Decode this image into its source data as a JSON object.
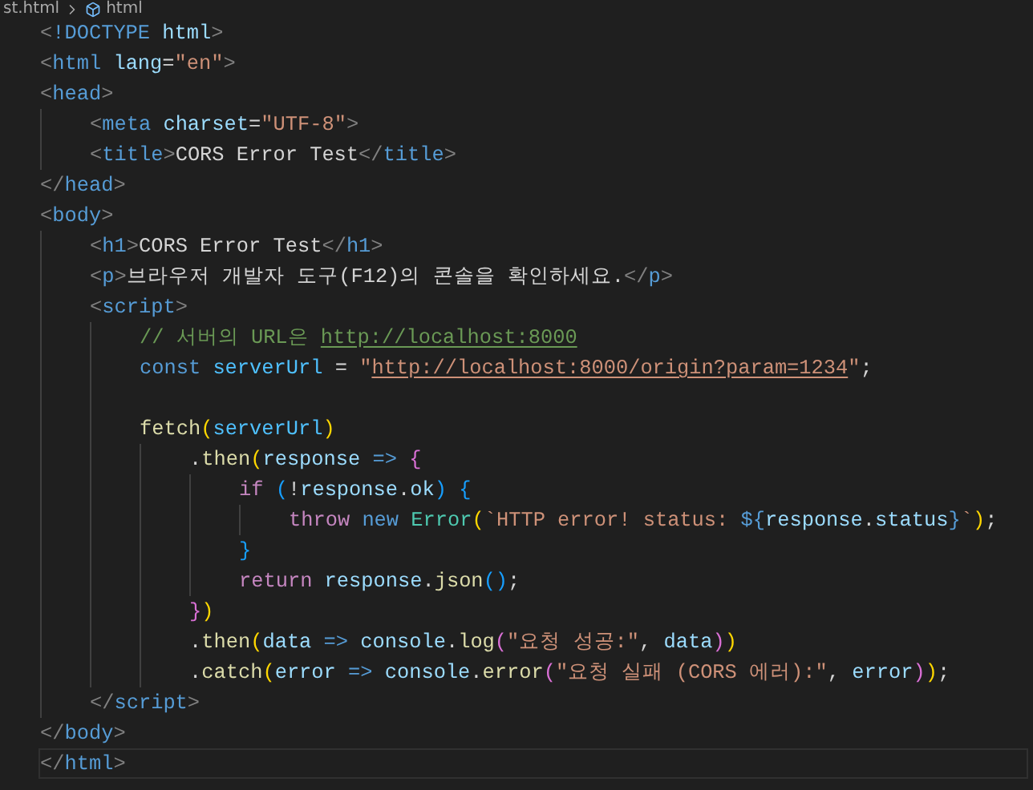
{
  "breadcrumb": {
    "file": "st.html",
    "symbol": "html"
  },
  "lines": [
    {
      "tokens": [
        {
          "kind": "punct",
          "text": "<"
        },
        {
          "kind": "tag",
          "text": "!DOCTYPE"
        },
        {
          "kind": "attr",
          "text": " html"
        },
        {
          "kind": "punct",
          "text": ">"
        }
      ]
    },
    {
      "tokens": [
        {
          "kind": "punct",
          "text": "<"
        },
        {
          "kind": "tag",
          "text": "html"
        },
        {
          "kind": "attr",
          "text": " lang"
        },
        {
          "kind": "text",
          "text": "="
        },
        {
          "kind": "string",
          "text": "\"en\""
        },
        {
          "kind": "punct",
          "text": ">"
        }
      ]
    },
    {
      "tokens": [
        {
          "kind": "punct",
          "text": "<"
        },
        {
          "kind": "tag",
          "text": "head"
        },
        {
          "kind": "punct",
          "text": ">"
        }
      ],
      "children": [
        {
          "tokens": [
            {
              "kind": "punct",
              "text": "<"
            },
            {
              "kind": "tag",
              "text": "meta"
            },
            {
              "kind": "attr",
              "text": " charset"
            },
            {
              "kind": "text",
              "text": "="
            },
            {
              "kind": "string",
              "text": "\"UTF-8\""
            },
            {
              "kind": "punct",
              "text": ">"
            }
          ]
        },
        {
          "tokens": [
            {
              "kind": "punct",
              "text": "<"
            },
            {
              "kind": "tag",
              "text": "title"
            },
            {
              "kind": "punct",
              "text": ">"
            },
            {
              "kind": "text",
              "text": "CORS Error Test"
            },
            {
              "kind": "punct",
              "text": "</"
            },
            {
              "kind": "tag",
              "text": "title"
            },
            {
              "kind": "punct",
              "text": ">"
            }
          ]
        }
      ]
    },
    {
      "tokens": [
        {
          "kind": "punct",
          "text": "</"
        },
        {
          "kind": "tag",
          "text": "head"
        },
        {
          "kind": "punct",
          "text": ">"
        }
      ]
    },
    {
      "tokens": [
        {
          "kind": "punct",
          "text": "<"
        },
        {
          "kind": "tag",
          "text": "body"
        },
        {
          "kind": "punct",
          "text": ">"
        }
      ],
      "children": [
        {
          "tokens": [
            {
              "kind": "punct",
              "text": "<"
            },
            {
              "kind": "tag",
              "text": "h1"
            },
            {
              "kind": "punct",
              "text": ">"
            },
            {
              "kind": "text",
              "text": "CORS Error Test"
            },
            {
              "kind": "punct",
              "text": "</"
            },
            {
              "kind": "tag",
              "text": "h1"
            },
            {
              "kind": "punct",
              "text": ">"
            }
          ]
        },
        {
          "tokens": [
            {
              "kind": "punct",
              "text": "<"
            },
            {
              "kind": "tag",
              "text": "p"
            },
            {
              "kind": "punct",
              "text": ">"
            },
            {
              "kind": "text",
              "text": "브라우저 개발자 도구(F12)의 콘솔을 확인하세요."
            },
            {
              "kind": "punct",
              "text": "</"
            },
            {
              "kind": "tag",
              "text": "p"
            },
            {
              "kind": "punct",
              "text": ">"
            }
          ]
        },
        {
          "tokens": [
            {
              "kind": "punct",
              "text": "<"
            },
            {
              "kind": "tag",
              "text": "script"
            },
            {
              "kind": "punct",
              "text": ">"
            }
          ],
          "children": [
            {
              "tokens": [
                {
                  "kind": "comment",
                  "text": "// 서버의 URL은 "
                },
                {
                  "kind": "comment",
                  "text": "http://localhost:8000",
                  "link": true
                }
              ]
            },
            {
              "tokens": [
                {
                  "kind": "keyword",
                  "text": "const"
                },
                {
                  "kind": "constant",
                  "text": " serverUrl"
                },
                {
                  "kind": "text",
                  "text": " = "
                },
                {
                  "kind": "string",
                  "text": "\""
                },
                {
                  "kind": "string",
                  "text": "http://localhost:8000/origin?param=1234",
                  "link": true
                },
                {
                  "kind": "string",
                  "text": "\""
                },
                {
                  "kind": "text",
                  "text": ";"
                }
              ]
            },
            {
              "blank_line_above": true,
              "tokens": [
                {
                  "kind": "function",
                  "text": "fetch"
                },
                {
                  "kind": "bracket1",
                  "text": "("
                },
                {
                  "kind": "constant",
                  "text": "serverUrl"
                },
                {
                  "kind": "bracket1",
                  "text": ")"
                }
              ],
              "children": [
                {
                  "tokens": [
                    {
                      "kind": "text",
                      "text": "."
                    },
                    {
                      "kind": "function",
                      "text": "then"
                    },
                    {
                      "kind": "bracket1",
                      "text": "("
                    },
                    {
                      "kind": "variable",
                      "text": "response"
                    },
                    {
                      "kind": "keyword",
                      "text": " =>"
                    },
                    {
                      "kind": "bracket2",
                      "text": " {"
                    }
                  ],
                  "children": [
                    {
                      "tokens": [
                        {
                          "kind": "control",
                          "text": "if"
                        },
                        {
                          "kind": "bracket3",
                          "text": " ("
                        },
                        {
                          "kind": "text",
                          "text": "!"
                        },
                        {
                          "kind": "variable",
                          "text": "response"
                        },
                        {
                          "kind": "text",
                          "text": "."
                        },
                        {
                          "kind": "variable",
                          "text": "ok"
                        },
                        {
                          "kind": "bracket3",
                          "text": ")"
                        },
                        {
                          "kind": "bracket3",
                          "text": " {"
                        }
                      ],
                      "children": [
                        {
                          "tokens": [
                            {
                              "kind": "control",
                              "text": "throw"
                            },
                            {
                              "kind": "keyword",
                              "text": " new"
                            },
                            {
                              "kind": "class",
                              "text": " Error"
                            },
                            {
                              "kind": "bracket1",
                              "text": "("
                            },
                            {
                              "kind": "string",
                              "text": "`HTTP error! status: "
                            },
                            {
                              "kind": "keyword",
                              "text": "${"
                            },
                            {
                              "kind": "variable",
                              "text": "response"
                            },
                            {
                              "kind": "text",
                              "text": "."
                            },
                            {
                              "kind": "variable",
                              "text": "status"
                            },
                            {
                              "kind": "keyword",
                              "text": "}"
                            },
                            {
                              "kind": "string",
                              "text": "`"
                            },
                            {
                              "kind": "bracket1",
                              "text": ")"
                            },
                            {
                              "kind": "text",
                              "text": ";"
                            }
                          ]
                        }
                      ]
                    },
                    {
                      "tokens": [
                        {
                          "kind": "bracket3",
                          "text": "}"
                        }
                      ]
                    },
                    {
                      "tokens": [
                        {
                          "kind": "control",
                          "text": "return"
                        },
                        {
                          "kind": "variable",
                          "text": " response"
                        },
                        {
                          "kind": "text",
                          "text": "."
                        },
                        {
                          "kind": "function",
                          "text": "json"
                        },
                        {
                          "kind": "bracket3",
                          "text": "()"
                        },
                        {
                          "kind": "text",
                          "text": ";"
                        }
                      ]
                    }
                  ]
                },
                {
                  "tokens": [
                    {
                      "kind": "bracket2",
                      "text": "}"
                    },
                    {
                      "kind": "bracket1",
                      "text": ")"
                    }
                  ]
                },
                {
                  "tokens": [
                    {
                      "kind": "text",
                      "text": "."
                    },
                    {
                      "kind": "function",
                      "text": "then"
                    },
                    {
                      "kind": "bracket1",
                      "text": "("
                    },
                    {
                      "kind": "variable",
                      "text": "data"
                    },
                    {
                      "kind": "keyword",
                      "text": " =>"
                    },
                    {
                      "kind": "variable",
                      "text": " console"
                    },
                    {
                      "kind": "text",
                      "text": "."
                    },
                    {
                      "kind": "function",
                      "text": "log"
                    },
                    {
                      "kind": "bracket2",
                      "text": "("
                    },
                    {
                      "kind": "string",
                      "text": "\"요청 성공:\""
                    },
                    {
                      "kind": "text",
                      "text": ","
                    },
                    {
                      "kind": "variable",
                      "text": " data"
                    },
                    {
                      "kind": "bracket2",
                      "text": ")"
                    },
                    {
                      "kind": "bracket1",
                      "text": ")"
                    }
                  ]
                },
                {
                  "tokens": [
                    {
                      "kind": "text",
                      "text": "."
                    },
                    {
                      "kind": "function",
                      "text": "catch"
                    },
                    {
                      "kind": "bracket1",
                      "text": "("
                    },
                    {
                      "kind": "variable",
                      "text": "error"
                    },
                    {
                      "kind": "keyword",
                      "text": " =>"
                    },
                    {
                      "kind": "variable",
                      "text": " console"
                    },
                    {
                      "kind": "text",
                      "text": "."
                    },
                    {
                      "kind": "function",
                      "text": "error"
                    },
                    {
                      "kind": "bracket2",
                      "text": "("
                    },
                    {
                      "kind": "string",
                      "text": "\"요청 실패 (CORS 에러):\""
                    },
                    {
                      "kind": "text",
                      "text": ","
                    },
                    {
                      "kind": "variable",
                      "text": " error"
                    },
                    {
                      "kind": "bracket2",
                      "text": ")"
                    },
                    {
                      "kind": "bracket1",
                      "text": ")"
                    },
                    {
                      "kind": "text",
                      "text": ";"
                    }
                  ]
                }
              ]
            }
          ]
        },
        {
          "tokens": [
            {
              "kind": "punct",
              "text": "</"
            },
            {
              "kind": "tag",
              "text": "script"
            },
            {
              "kind": "punct",
              "text": ">"
            }
          ]
        }
      ]
    },
    {
      "tokens": [
        {
          "kind": "punct",
          "text": "</"
        },
        {
          "kind": "tag",
          "text": "body"
        },
        {
          "kind": "punct",
          "text": ">"
        }
      ]
    },
    {
      "current": true,
      "tokens": [
        {
          "kind": "punct",
          "text": "</"
        },
        {
          "kind": "tag",
          "text": "html"
        },
        {
          "kind": "punct",
          "text": ">"
        }
      ]
    }
  ]
}
